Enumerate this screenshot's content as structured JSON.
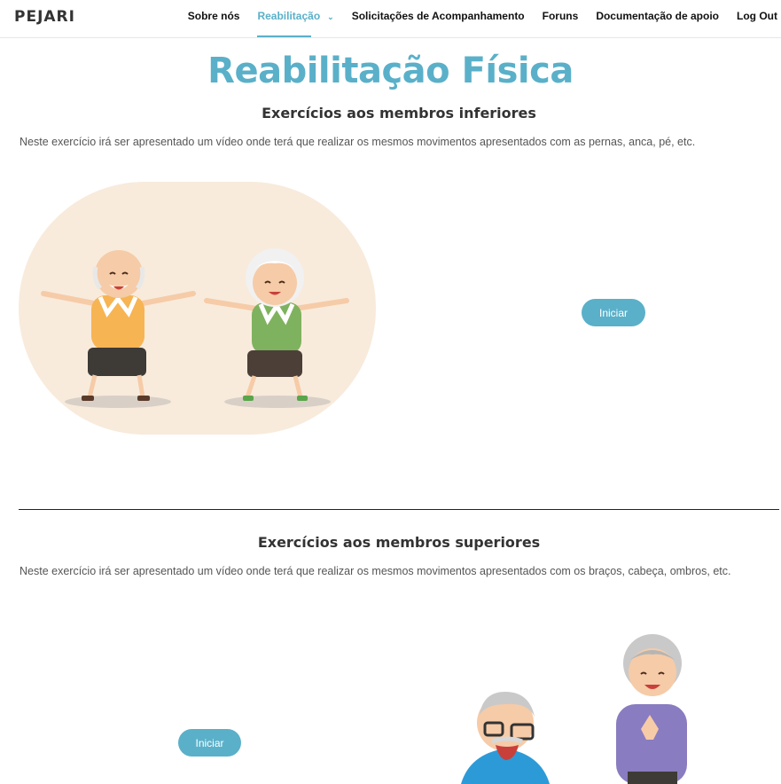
{
  "header": {
    "logo": "PEJARI",
    "nav": [
      {
        "label": "Sobre nós"
      },
      {
        "label": "Reabilitação",
        "active": true,
        "dropdown_icon": "chevron-down-icon"
      },
      {
        "label": "Solicitações de Acompanhamento"
      },
      {
        "label": "Foruns"
      },
      {
        "label": "Documentação de apoio"
      },
      {
        "label": "Log Out"
      }
    ]
  },
  "page": {
    "title": "Reabilitação Física"
  },
  "sections": [
    {
      "title": "Exercícios aos membros inferiores",
      "description": "Neste exercício irá ser apresentado um vídeo onde terá que realizar os mesmos movimentos apresentados com as pernas, anca, pé, etc.",
      "button": "Iniciar",
      "image": "elderly-couple-exercising-illustration"
    },
    {
      "title": "Exercícios aos membros superiores",
      "description": "Neste exercício irá ser apresentado um vídeo onde terá que realizar os mesmos movimentos apresentados com os braços, cabeça, ombros, etc.",
      "button": "Iniciar",
      "image": "elderly-couple-upper-body-illustration"
    }
  ],
  "colors": {
    "accent": "#5ab0c9",
    "illustration_bg": "#f8ebdc"
  }
}
